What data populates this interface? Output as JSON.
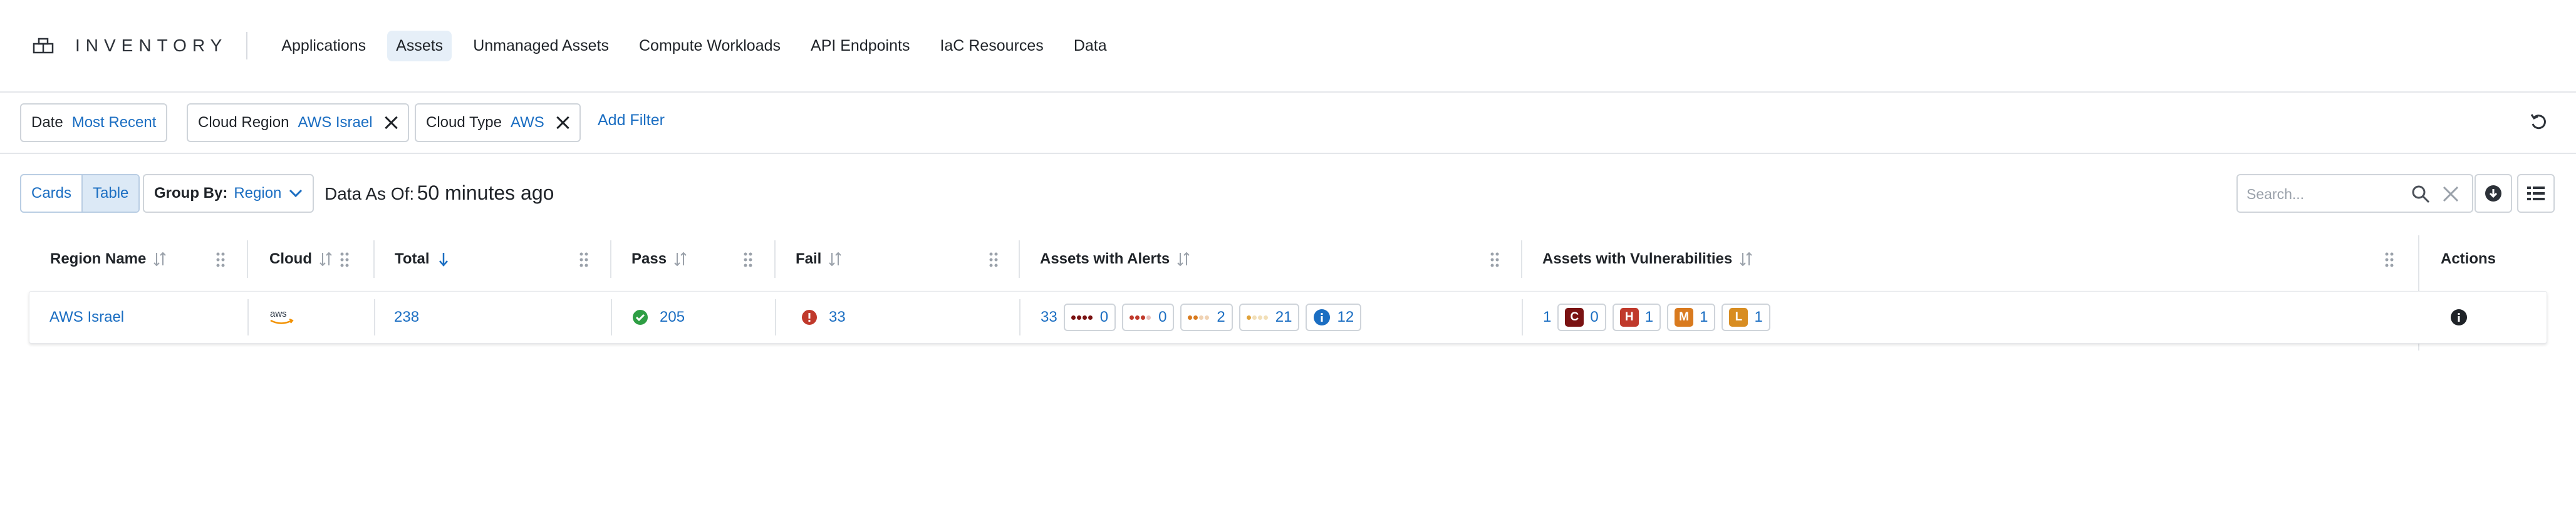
{
  "header": {
    "app_title": "INVENTORY",
    "nav": [
      {
        "label": "Applications"
      },
      {
        "label": "Assets"
      },
      {
        "label": "Unmanaged Assets"
      },
      {
        "label": "Compute Workloads"
      },
      {
        "label": "API Endpoints"
      },
      {
        "label": "IaC Resources"
      },
      {
        "label": "Data"
      }
    ],
    "active_nav": "Assets"
  },
  "filters": [
    {
      "key": "Date",
      "value": "Most Recent",
      "removable": false
    },
    {
      "key": "Cloud Region",
      "value": "AWS Israel",
      "removable": true
    },
    {
      "key": "Cloud Type",
      "value": "AWS",
      "removable": true
    }
  ],
  "add_filter_label": "Add Filter",
  "toolbar": {
    "view_options": [
      "Cards",
      "Table"
    ],
    "selected_view": "Table",
    "group_by_label": "Group By:",
    "group_by_value": "Region",
    "data_as_of_label": "Data As Of:",
    "data_as_of_value": "50 minutes ago",
    "search_placeholder": "Search..."
  },
  "table": {
    "columns": [
      "Region Name",
      "Cloud",
      "Total",
      "Pass",
      "Fail",
      "Assets with Alerts",
      "Assets with Vulnerabilities",
      "Actions"
    ],
    "rows": [
      {
        "region": "AWS Israel",
        "cloud": "aws",
        "total": "238",
        "pass": "205",
        "fail": "33",
        "alerts_total": "33",
        "alerts": [
          {
            "severity": "critical",
            "count": "0"
          },
          {
            "severity": "high",
            "count": "0"
          },
          {
            "severity": "medium",
            "count": "2"
          },
          {
            "severity": "low",
            "count": "21"
          },
          {
            "severity": "informational",
            "count": "12"
          }
        ],
        "vulns_total": "1",
        "vulns": [
          {
            "letter": "C",
            "count": "0"
          },
          {
            "letter": "H",
            "count": "1"
          },
          {
            "letter": "M",
            "count": "1"
          },
          {
            "letter": "L",
            "count": "1"
          }
        ]
      }
    ]
  },
  "colors": {
    "accent": "#1b6ec2",
    "pass": "#2e9e44",
    "fail": "#c0392b",
    "critical": "#7a1212",
    "high": "#c0392b",
    "medium": "#d97a1e",
    "low": "#e0a23a",
    "info": "#1b6ec2"
  }
}
